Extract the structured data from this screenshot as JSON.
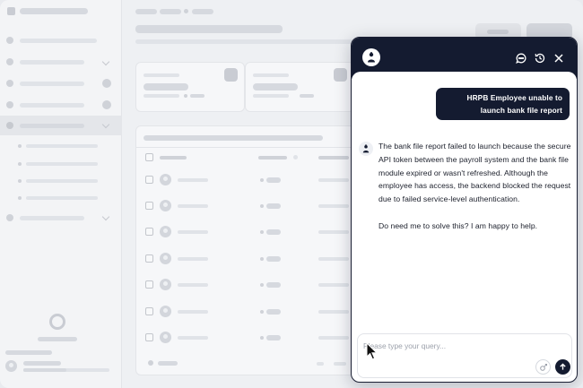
{
  "chat": {
    "user_message": "HRPB Employee unable to launch bank file report",
    "bot_paragraph_1": "The bank file report failed to launch because the secure API token between the payroll system and the bank file module expired or wasn't refreshed. Although the employee has access, the backend blocked the request due to failed service-level authentication.",
    "bot_paragraph_2": "Do need me to solve this? I am happy to help.",
    "input_placeholder": "Please type your query...",
    "input_value": ""
  },
  "icons": {
    "bot_avatar": "bot-person-icon",
    "history": "history-icon",
    "chat_bubble": "chat-bubble-icon",
    "close": "close-icon",
    "attach": "attach-icon",
    "send": "arrow-up-icon",
    "cursor": "mouse-pointer-icon"
  },
  "colors": {
    "header_bg": "#141b30",
    "user_bubble_bg": "#141b30",
    "send_button_bg": "#141b30",
    "skeleton": "#d6d9df"
  }
}
